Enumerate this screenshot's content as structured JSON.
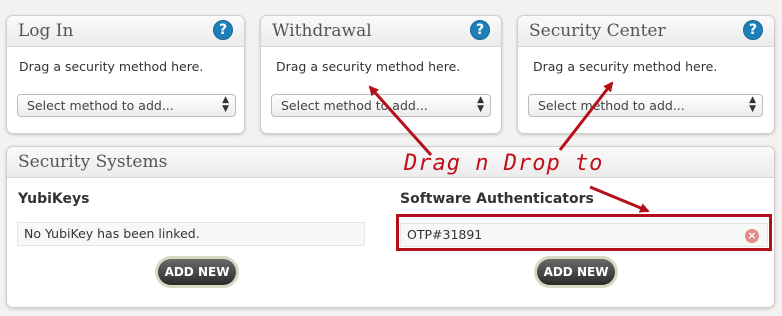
{
  "panels": [
    {
      "title": "Log In",
      "hint": "Drag a security method here.",
      "select_value": "Select method to add..."
    },
    {
      "title": "Withdrawal",
      "hint": "Drag a security method here.",
      "select_value": "Select method to add..."
    },
    {
      "title": "Security Center",
      "hint": "Drag a security method here.",
      "select_value": "Select method to add..."
    }
  ],
  "help_icon_glyph": "?",
  "security_systems": {
    "title": "Security Systems",
    "yubikeys": {
      "heading": "YubiKeys",
      "empty_text": "No YubiKey has been linked.",
      "add_label": "ADD NEW"
    },
    "software_auth": {
      "heading": "Software Authenticators",
      "item": "OTP#31891",
      "remove_glyph": "×",
      "add_label": "ADD NEW"
    }
  },
  "annotation": {
    "text": "Drag n Drop to",
    "color": "#c0101b"
  },
  "colors": {
    "help_blue": "#1f7fb8",
    "annotation_red": "#b3101a"
  }
}
